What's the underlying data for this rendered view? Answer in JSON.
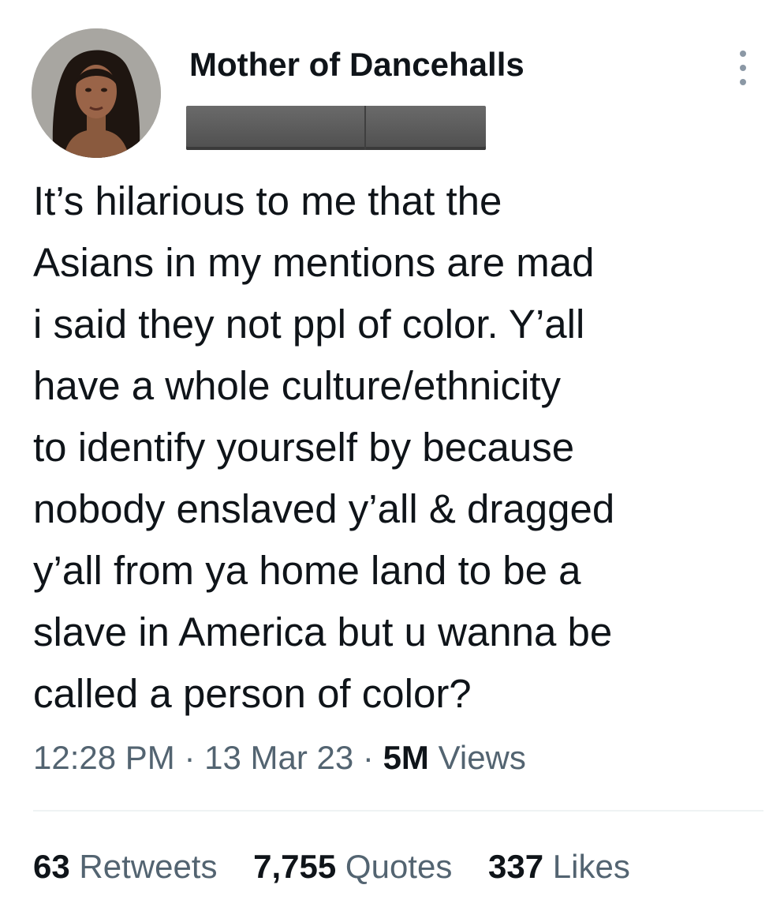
{
  "tweet": {
    "display_name": "Mother of Dancehalls",
    "text_lines": [
      "It’s hilarious to me that the",
      "Asians in my mentions are mad",
      "i said they not ppl of color. Y’all",
      "have a whole culture/ethnicity",
      "to identify yourself by because",
      "nobody enslaved y’all & dragged",
      "y’all from ya home land to be a",
      "slave in America but u wanna be",
      "called a person of color?"
    ],
    "time": "12:28 PM",
    "date": "13 Mar 23",
    "separator": "·",
    "views_count": "5M",
    "views_label": "Views",
    "stats": {
      "retweets_count": "63",
      "retweets_label": "Retweets",
      "quotes_count": "7,755",
      "quotes_label": "Quotes",
      "likes_count": "337",
      "likes_label": "Likes"
    }
  },
  "icons": {
    "more": "more-vertical-icon"
  },
  "colors": {
    "text_primary": "#0f1419",
    "text_secondary": "#536471",
    "divider": "#eff3f4",
    "redaction": "#5a5a5a"
  }
}
